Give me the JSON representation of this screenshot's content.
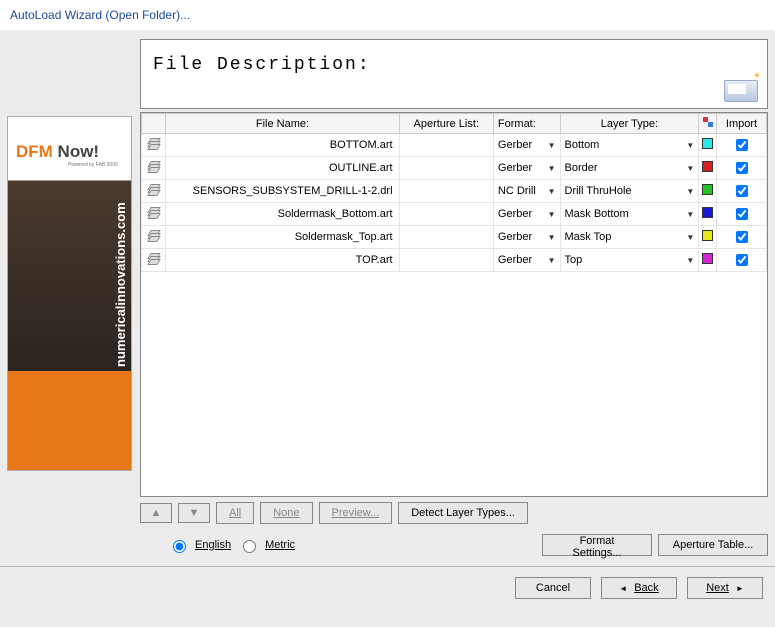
{
  "title": "AutoLoad Wizard (Open Folder)...",
  "description_label": "File Description:",
  "ad": {
    "text1": "DFM",
    "text2": " Now!",
    "powered": "Powered by FAB 3000",
    "url": "numericalinnovations.com"
  },
  "headers": {
    "file": "File Name:",
    "aperture": "Aperture List:",
    "format": "Format:",
    "layer": "Layer Type:",
    "import": "Import"
  },
  "rows": [
    {
      "file": "BOTTOM.art",
      "aperture": "",
      "format": "Gerber",
      "layer": "Bottom",
      "swatch": "#2fe7e7",
      "import": true
    },
    {
      "file": "OUTLINE.art",
      "aperture": "",
      "format": "Gerber",
      "layer": "Border",
      "swatch": "#d22222",
      "import": true
    },
    {
      "file": "SENSORS_SUBSYSTEM_DRILL-1-2.drl",
      "aperture": "",
      "format": "NC Drill",
      "layer": "Drill ThruHole",
      "swatch": "#22c322",
      "import": true
    },
    {
      "file": "Soldermask_Bottom.art",
      "aperture": "",
      "format": "Gerber",
      "layer": "Mask Bottom",
      "swatch": "#1818d8",
      "import": true
    },
    {
      "file": "Soldermask_Top.art",
      "aperture": "",
      "format": "Gerber",
      "layer": "Mask Top",
      "swatch": "#e7e720",
      "import": true
    },
    {
      "file": "TOP.art",
      "aperture": "",
      "format": "Gerber",
      "layer": "Top",
      "swatch": "#d428d4",
      "import": true
    }
  ],
  "toolbar": {
    "all": "All",
    "none": "None",
    "preview": "Preview...",
    "detect": "Detect Layer Types...",
    "format_settings": "Format Settings...",
    "aperture_table": "Aperture Table..."
  },
  "units": {
    "english": "English",
    "metric": "Metric",
    "selected": "english"
  },
  "nav": {
    "cancel": "Cancel",
    "back": "Back",
    "next": "Next"
  }
}
